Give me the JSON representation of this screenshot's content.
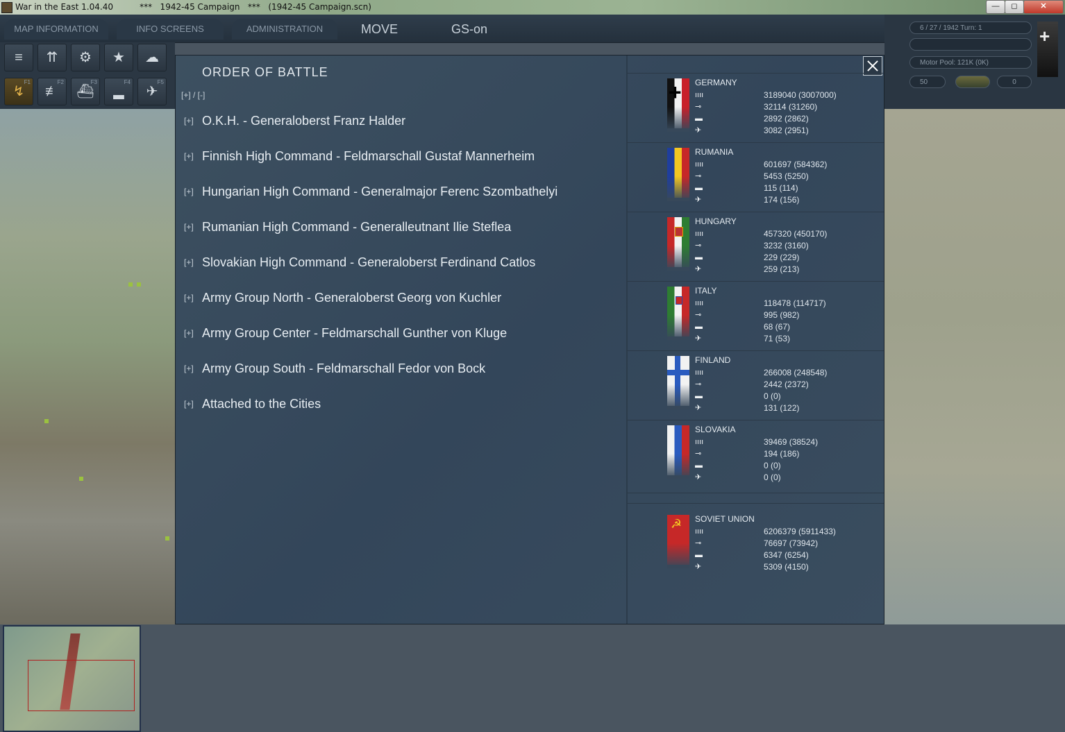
{
  "window": {
    "title": "War in the East 1.04.40          ***   1942-45 Campaign   ***   (1942-45 Campaign.scn)",
    "minimize": "—",
    "maximize": "◻",
    "close": "✕"
  },
  "menu": {
    "map_information": "MAP INFORMATION",
    "info_screens": "INFO SCREENS",
    "administration": "ADMINISTRATION",
    "move": "MOVE",
    "gs_on": "GS-on"
  },
  "toolbar": {
    "row1_icons": [
      "unit-stack-icon",
      "sliders-icon",
      "gear-icon",
      "star-icon",
      "weather-icon"
    ],
    "row2": [
      {
        "icon": "movement-path-icon",
        "key": "F1",
        "active": true
      },
      {
        "icon": "rail-icon",
        "key": "F2",
        "active": false
      },
      {
        "icon": "naval-icon",
        "key": "F3",
        "active": false
      },
      {
        "icon": "ship-icon",
        "key": "F4",
        "active": false
      },
      {
        "icon": "air-icon",
        "key": "F5",
        "active": false
      }
    ]
  },
  "hud": {
    "date_turn": "6 / 27 / 1942      Turn: 1",
    "motor_pool": "Motor Pool:  121K (0K)",
    "zoom": "50",
    "counter": "0"
  },
  "dialog": {
    "title": "ORDER OF BATTLE",
    "toggle_all": "[+]  /  [-]",
    "expand_symbol": "[+]",
    "commands": [
      {
        "name": "O.K.H.   -   Generaloberst Franz Halder"
      },
      {
        "name": "Finnish High Command   -   Feldmarschall Gustaf Mannerheim"
      },
      {
        "name": "Hungarian High Command   -   Generalmajor Ferenc Szombathelyi"
      },
      {
        "name": "Rumanian High Command   -   Generalleutnant Ilie Steflea"
      },
      {
        "name": "Slovakian High Command   -   Generaloberst Ferdinand Catlos"
      },
      {
        "name": "Army Group North   -   Generaloberst Georg von Kuchler"
      },
      {
        "name": "Army Group Center   -   Feldmarschall Gunther von Kluge"
      },
      {
        "name": "Army Group South   -   Feldmarschall Fedor von Bock"
      },
      {
        "name": "Attached to the Cities"
      }
    ]
  },
  "nations": [
    {
      "name": "GERMANY",
      "men": "3189040 (3007000)",
      "guns": "32114 (31260)",
      "afv": "2892 (2862)",
      "aircraft": "3082 (2951)"
    },
    {
      "name": "RUMANIA",
      "men": "601697 (584362)",
      "guns": "5453 (5250)",
      "afv": "115 (114)",
      "aircraft": "174 (156)"
    },
    {
      "name": "HUNGARY",
      "men": "457320 (450170)",
      "guns": "3232 (3160)",
      "afv": "229 (229)",
      "aircraft": "259 (213)"
    },
    {
      "name": "ITALY",
      "men": "118478 (114717)",
      "guns": "995 (982)",
      "afv": "68 (67)",
      "aircraft": "71 (53)"
    },
    {
      "name": "FINLAND",
      "men": "266008 (248548)",
      "guns": "2442 (2372)",
      "afv": "0 (0)",
      "aircraft": "131 (122)"
    },
    {
      "name": "SLOVAKIA",
      "men": "39469 (38524)",
      "guns": "194 (186)",
      "afv": "0 (0)",
      "aircraft": "0 (0)"
    }
  ],
  "soviet": {
    "name": "SOVIET UNION",
    "men": "6206379 (5911433)",
    "guns": "76697 (73942)",
    "afv": "6347 (6254)",
    "aircraft": "5309 (4150)"
  },
  "glyphs": {
    "men": "ıııı",
    "guns": "⊸",
    "afv": "▬",
    "aircraft": "✈"
  },
  "colors": {
    "dialog_bg": "#3a4d5f",
    "active_tool": "#e2b24a",
    "minimap_view": "#b02020"
  }
}
